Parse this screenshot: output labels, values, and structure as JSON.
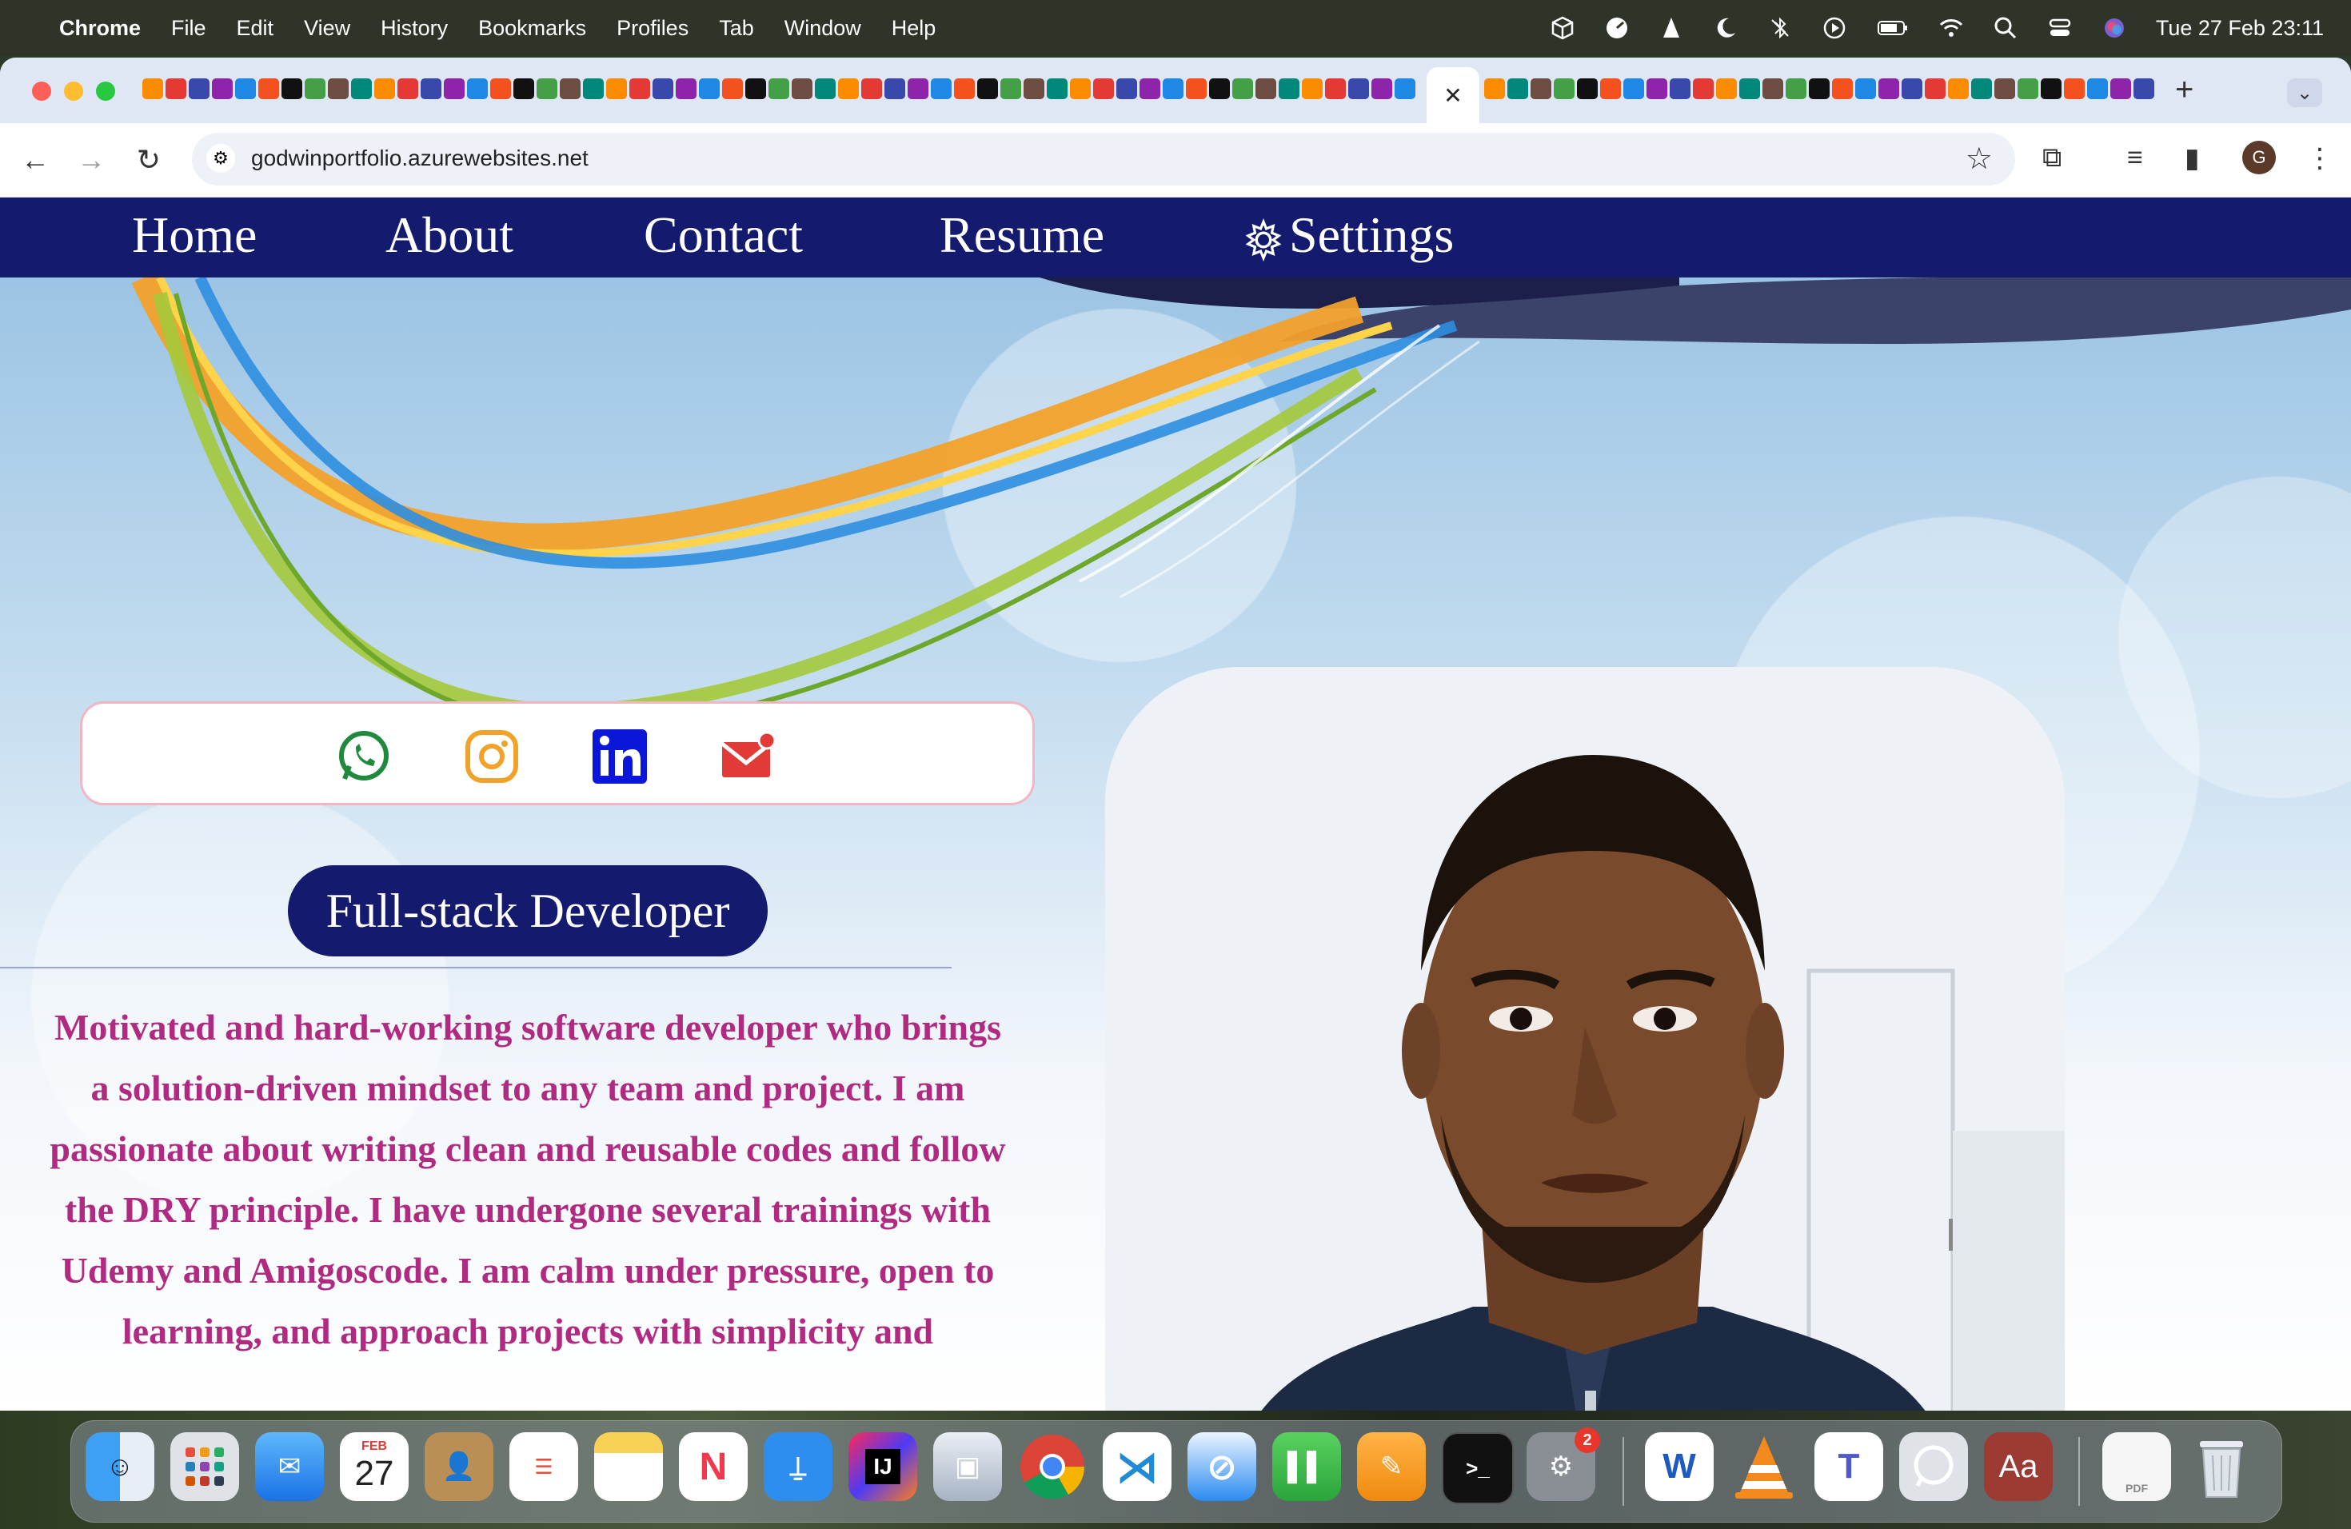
{
  "menubar": {
    "app_name": "Chrome",
    "items": [
      "File",
      "Edit",
      "View",
      "History",
      "Bookmarks",
      "Profiles",
      "Tab",
      "Window",
      "Help"
    ],
    "clock": "Tue 27 Feb  23:11"
  },
  "browser": {
    "active_tab_close": "✕",
    "new_tab": "+",
    "tab_menu": "⌄",
    "url": "godwinportfolio.azurewebsites.net",
    "profile_initial": "G"
  },
  "site": {
    "nav": {
      "home": "Home",
      "about": "About",
      "contact": "Contact",
      "resume": "Resume",
      "settings": "Settings"
    },
    "social_icons": [
      "whatsapp-icon",
      "instagram-icon",
      "linkedin-icon",
      "mail-icon"
    ],
    "role": "Full-stack Developer",
    "bio": "Motivated and hard-working software developer who brings a solution-driven mindset to any team and project. I am passionate about writing clean and reusable codes and follow the DRY principle. I have undergone several trainings with Udemy and Amigoscode. I am calm under pressure, open to learning, and approach projects with simplicity and",
    "colors": {
      "nav_bg": "#141a6e",
      "bio_text": "#b02a82",
      "social_border": "#f1b6c2"
    }
  },
  "dock": {
    "calendar_month": "FEB",
    "calendar_day": "27",
    "settings_badge": "2",
    "intellij_label": "IJ",
    "word_label": "W",
    "dictionary_label": "Aa",
    "pdf_label": "PDF"
  }
}
